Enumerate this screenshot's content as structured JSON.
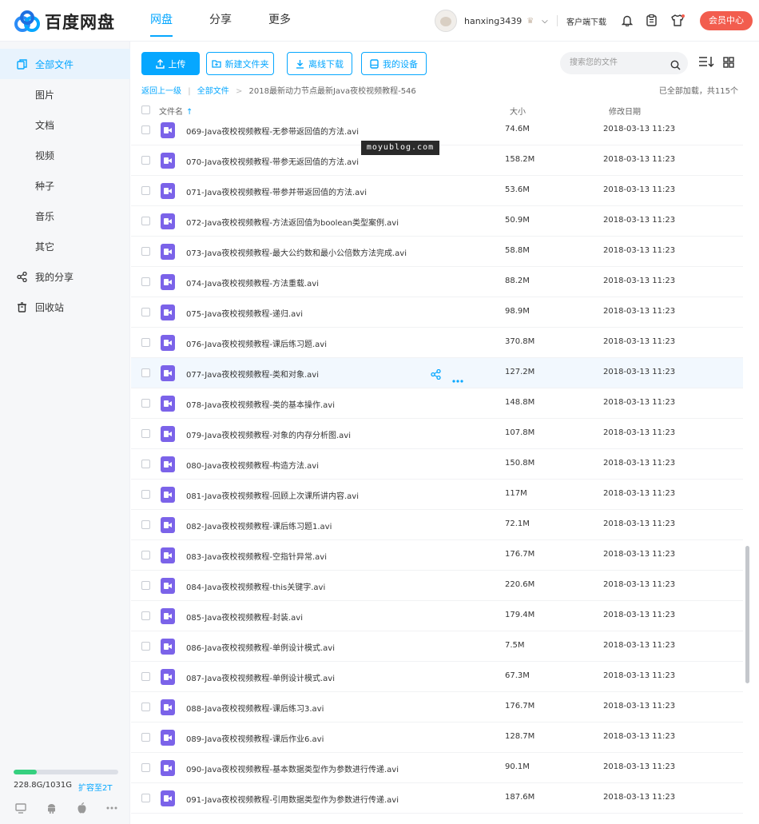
{
  "app": {
    "logo_text": "百度网盘"
  },
  "nav": {
    "tabs": [
      {
        "label": "网盘",
        "active": true
      },
      {
        "label": "分享",
        "active": false
      },
      {
        "label": "更多",
        "active": false
      }
    ]
  },
  "user": {
    "name": "hanxing3439",
    "client_download": "客户端下载",
    "vip_button": "会员中心"
  },
  "sidebar": {
    "items": [
      {
        "label": "全部文件",
        "icon": "all-files-icon",
        "active": true
      },
      {
        "label": "图片"
      },
      {
        "label": "文档"
      },
      {
        "label": "视频"
      },
      {
        "label": "种子"
      },
      {
        "label": "音乐"
      },
      {
        "label": "其它"
      },
      {
        "label": "我的分享",
        "icon": "share-icon"
      },
      {
        "label": "回收站",
        "icon": "trash-icon"
      }
    ],
    "quota": {
      "text": "228.8G/1031G",
      "used_fraction": 0.22,
      "expand_label": "扩容至2T"
    }
  },
  "toolbar": {
    "upload": "上传",
    "new_folder": "新建文件夹",
    "offline_download": "离线下载",
    "my_devices": "我的设备",
    "search_placeholder": "搜索您的文件"
  },
  "breadcrumb": {
    "back": "返回上一级",
    "root": "全部文件",
    "current": "2018最新动力节点最新Java夜校视频教程-546",
    "loaded_text": "已全部加载，共115个"
  },
  "table": {
    "headers": {
      "name": "文件名",
      "size": "大小",
      "date": "修改日期"
    },
    "rows": [
      {
        "name": "069-Java夜校视频教程-无参带返回值的方法.avi",
        "size": "74.6M",
        "date": "2018-03-13 11:23"
      },
      {
        "name": "070-Java夜校视频教程-带参无返回值的方法.avi",
        "size": "158.2M",
        "date": "2018-03-13 11:23"
      },
      {
        "name": "071-Java夜校视频教程-带参并带返回值的方法.avi",
        "size": "53.6M",
        "date": "2018-03-13 11:23"
      },
      {
        "name": "072-Java夜校视频教程-方法返回值为boolean类型案例.avi",
        "size": "50.9M",
        "date": "2018-03-13 11:23"
      },
      {
        "name": "073-Java夜校视频教程-最大公约数和最小公倍数方法完成.avi",
        "size": "58.8M",
        "date": "2018-03-13 11:23"
      },
      {
        "name": "074-Java夜校视频教程-方法重载.avi",
        "size": "88.2M",
        "date": "2018-03-13 11:23"
      },
      {
        "name": "075-Java夜校视频教程-递归.avi",
        "size": "98.9M",
        "date": "2018-03-13 11:23"
      },
      {
        "name": "076-Java夜校视频教程-课后练习题.avi",
        "size": "370.8M",
        "date": "2018-03-13 11:23"
      },
      {
        "name": "077-Java夜校视频教程-类和对象.avi",
        "size": "127.2M",
        "date": "2018-03-13 11:23",
        "hover": true
      },
      {
        "name": "078-Java夜校视频教程-类的基本操作.avi",
        "size": "148.8M",
        "date": "2018-03-13 11:23"
      },
      {
        "name": "079-Java夜校视频教程-对象的内存分析图.avi",
        "size": "107.8M",
        "date": "2018-03-13 11:23"
      },
      {
        "name": "080-Java夜校视频教程-构造方法.avi",
        "size": "150.8M",
        "date": "2018-03-13 11:23"
      },
      {
        "name": "081-Java夜校视频教程-回顾上次课所讲内容.avi",
        "size": "117M",
        "date": "2018-03-13 11:23"
      },
      {
        "name": "082-Java夜校视频教程-课后练习题1.avi",
        "size": "72.1M",
        "date": "2018-03-13 11:23"
      },
      {
        "name": "083-Java夜校视频教程-空指针异常.avi",
        "size": "176.7M",
        "date": "2018-03-13 11:23"
      },
      {
        "name": "084-Java夜校视频教程-this关键字.avi",
        "size": "220.6M",
        "date": "2018-03-13 11:23"
      },
      {
        "name": "085-Java夜校视频教程-封装.avi",
        "size": "179.4M",
        "date": "2018-03-13 11:23"
      },
      {
        "name": "086-Java夜校视频教程-单例设计模式.avi",
        "size": "7.5M",
        "date": "2018-03-13 11:23"
      },
      {
        "name": "087-Java夜校视频教程-单例设计模式.avi",
        "size": "67.3M",
        "date": "2018-03-13 11:23"
      },
      {
        "name": "088-Java夜校视频教程-课后练习3.avi",
        "size": "176.7M",
        "date": "2018-03-13 11:23"
      },
      {
        "name": "089-Java夜校视频教程-课后作业6.avi",
        "size": "128.7M",
        "date": "2018-03-13 11:23"
      },
      {
        "name": "090-Java夜校视频教程-基本数据类型作为参数进行传递.avi",
        "size": "90.1M",
        "date": "2018-03-13 11:23"
      },
      {
        "name": "091-Java夜校视频教程-引用数据类型作为参数进行传递.avi",
        "size": "187.6M",
        "date": "2018-03-13 11:23"
      }
    ]
  },
  "watermark": "moyublog.com",
  "colors": {
    "accent": "#06a7ff",
    "vip": "#f25d4e",
    "quota": "#35d07f",
    "video_icon": "#7b63e9"
  }
}
